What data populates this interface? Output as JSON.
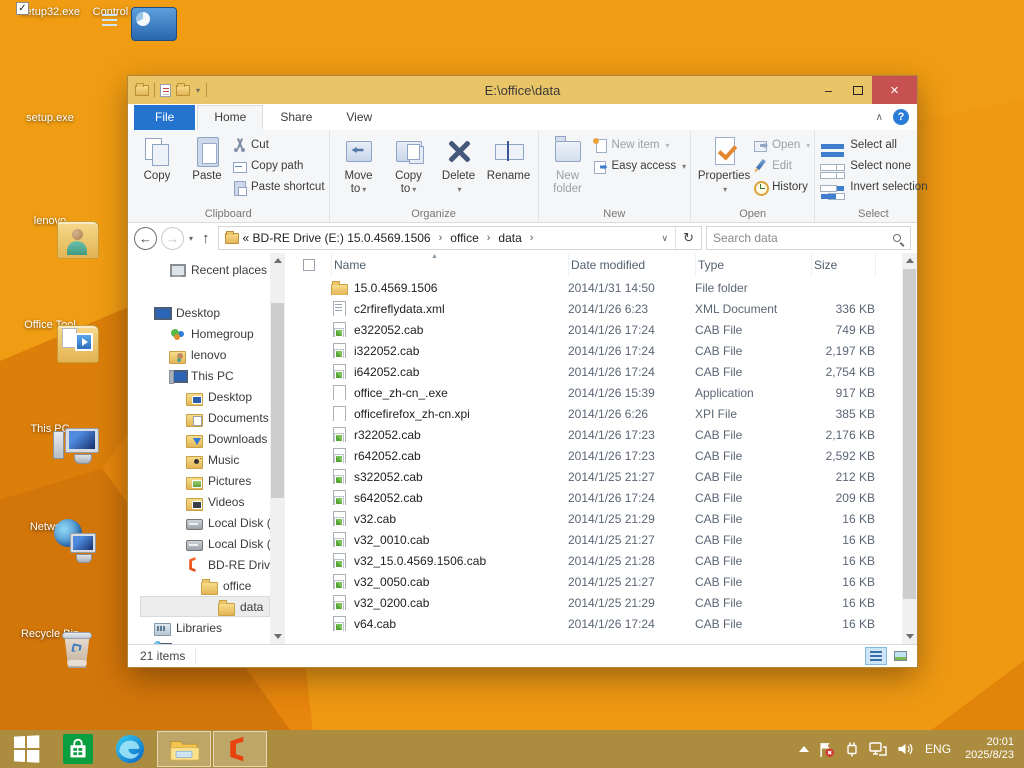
{
  "glyphs": {
    "check": "✓",
    "dropdown": "▾",
    "sort": "▲",
    "collapse": "∧",
    "help": "?",
    "back": "←",
    "forward": "→",
    "up": "↑",
    "refresh": "↻",
    "crumb_sep": "›",
    "chevron_down": "∨",
    "minimize": "–",
    "close": "×"
  },
  "colors": {
    "title_gold": "#eac568",
    "desktop_orange": "#e8860d",
    "accent_blue": "#2373cf",
    "close_red": "#c75050",
    "taskbar_gold": "#ac8c3e"
  },
  "desktop": {
    "icons": [
      {
        "label": "setup32.exe",
        "icon": "office",
        "checked": true
      },
      {
        "label": "Control Panel",
        "icon": "cpanel"
      },
      {
        "label": "setup.exe",
        "icon": "office"
      },
      {
        "label": "lenovo",
        "icon": "fuser"
      },
      {
        "label": "Office Tool",
        "icon": "ftool"
      },
      {
        "label": "This PC",
        "icon": "thispc"
      },
      {
        "label": "Network",
        "icon": "network"
      },
      {
        "label": "Recycle Bin",
        "icon": "recycle"
      }
    ]
  },
  "window": {
    "title": "E:\\office\\data",
    "tabs": {
      "file": "File",
      "home": "Home",
      "share": "Share",
      "view": "View"
    },
    "ribbon": {
      "copy": "Copy",
      "paste": "Paste",
      "cut": "Cut",
      "copy_path": "Copy path",
      "paste_shortcut": "Paste shortcut",
      "clipboard_group": "Clipboard",
      "move_line1": "Move",
      "move_line2": "to",
      "copyto_line1": "Copy",
      "copyto_line2": "to",
      "delete": "Delete",
      "rename": "Rename",
      "organize_group": "Organize",
      "new_folder_line1": "New",
      "new_folder_line2": "folder",
      "new_item": "New item",
      "easy_access": "Easy access",
      "new_group": "New",
      "properties": "Properties",
      "open": "Open",
      "edit": "Edit",
      "history": "History",
      "open_group": "Open",
      "select_all": "Select all",
      "select_none": "Select none",
      "invert_selection": "Invert selection",
      "select_group": "Select"
    },
    "address": {
      "crumbs": [
        "« BD-RE Drive (E:) 15.0.4569.1506",
        "office",
        "data"
      ],
      "search_placeholder": "Search data"
    },
    "columns": {
      "name": "Name",
      "date": "Date modified",
      "type": "Type",
      "size": "Size"
    },
    "status": {
      "items_count": "21 items"
    }
  },
  "nav": {
    "items": [
      {
        "label": "Recent places",
        "depth": 2,
        "icon": "recent",
        "gap_after": true
      },
      {
        "label": "Desktop",
        "depth": 1,
        "icon": "desktop"
      },
      {
        "label": "Homegroup",
        "depth": 2,
        "icon": "homegroup"
      },
      {
        "label": "lenovo",
        "depth": 2,
        "icon": "user"
      },
      {
        "label": "This PC",
        "depth": 2,
        "icon": "pc"
      },
      {
        "label": "Desktop",
        "depth": 3,
        "icon": "fdesktop"
      },
      {
        "label": "Documents",
        "depth": 3,
        "icon": "fdocs"
      },
      {
        "label": "Downloads",
        "depth": 3,
        "icon": "fdown"
      },
      {
        "label": "Music",
        "depth": 3,
        "icon": "fmusic"
      },
      {
        "label": "Pictures",
        "depth": 3,
        "icon": "fpics"
      },
      {
        "label": "Videos",
        "depth": 3,
        "icon": "fvids"
      },
      {
        "label": "Local Disk (C:)",
        "depth": 3,
        "icon": "disk"
      },
      {
        "label": "Local Disk (D:)",
        "depth": 3,
        "icon": "disk"
      },
      {
        "label": "BD-RE Drive (E:",
        "depth": 3,
        "icon": "office"
      },
      {
        "label": "office",
        "depth": 4,
        "icon": "folder"
      },
      {
        "label": "data",
        "depth": 5,
        "icon": "folder",
        "selected": true
      },
      {
        "label": "Libraries",
        "depth": 1,
        "icon": "libraries"
      },
      {
        "label": "Network",
        "depth": 1,
        "icon": "network"
      }
    ]
  },
  "files": {
    "rows": [
      {
        "icon": "folder",
        "name": "15.0.4569.1506",
        "date": "2014/1/31 14:50",
        "type": "File folder",
        "size": ""
      },
      {
        "icon": "xml",
        "name": "c2rfireflydata.xml",
        "date": "2014/1/26 6:23",
        "type": "XML Document",
        "size": "336 KB"
      },
      {
        "icon": "cab",
        "name": "e322052.cab",
        "date": "2014/1/26 17:24",
        "type": "CAB File",
        "size": "749 KB"
      },
      {
        "icon": "cab",
        "name": "i322052.cab",
        "date": "2014/1/26 17:24",
        "type": "CAB File",
        "size": "2,197 KB"
      },
      {
        "icon": "cab",
        "name": "i642052.cab",
        "date": "2014/1/26 17:24",
        "type": "CAB File",
        "size": "2,754 KB"
      },
      {
        "icon": "file",
        "name": "office_zh-cn_.exe",
        "date": "2014/1/26 15:39",
        "type": "Application",
        "size": "917 KB"
      },
      {
        "icon": "file",
        "name": "officefirefox_zh-cn.xpi",
        "date": "2014/1/26 6:26",
        "type": "XPI File",
        "size": "385 KB"
      },
      {
        "icon": "cab",
        "name": "r322052.cab",
        "date": "2014/1/26 17:23",
        "type": "CAB File",
        "size": "2,176 KB"
      },
      {
        "icon": "cab",
        "name": "r642052.cab",
        "date": "2014/1/26 17:23",
        "type": "CAB File",
        "size": "2,592 KB"
      },
      {
        "icon": "cab",
        "name": "s322052.cab",
        "date": "2014/1/25 21:27",
        "type": "CAB File",
        "size": "212 KB"
      },
      {
        "icon": "cab",
        "name": "s642052.cab",
        "date": "2014/1/26 17:24",
        "type": "CAB File",
        "size": "209 KB"
      },
      {
        "icon": "cab",
        "name": "v32.cab",
        "date": "2014/1/25 21:29",
        "type": "CAB File",
        "size": "16 KB"
      },
      {
        "icon": "cab",
        "name": "v32_0010.cab",
        "date": "2014/1/25 21:27",
        "type": "CAB File",
        "size": "16 KB"
      },
      {
        "icon": "cab",
        "name": "v32_15.0.4569.1506.cab",
        "date": "2014/1/25 21:28",
        "type": "CAB File",
        "size": "16 KB"
      },
      {
        "icon": "cab",
        "name": "v32_0050.cab",
        "date": "2014/1/25 21:27",
        "type": "CAB File",
        "size": "16 KB"
      },
      {
        "icon": "cab",
        "name": "v32_0200.cab",
        "date": "2014/1/25 21:29",
        "type": "CAB File",
        "size": "16 KB"
      },
      {
        "icon": "cab",
        "name": "v64.cab",
        "date": "2014/1/26 17:24",
        "type": "CAB File",
        "size": "16 KB"
      }
    ]
  },
  "taskbar": {
    "lang": "ENG",
    "time": "20:01",
    "date": "2025/8/23"
  }
}
